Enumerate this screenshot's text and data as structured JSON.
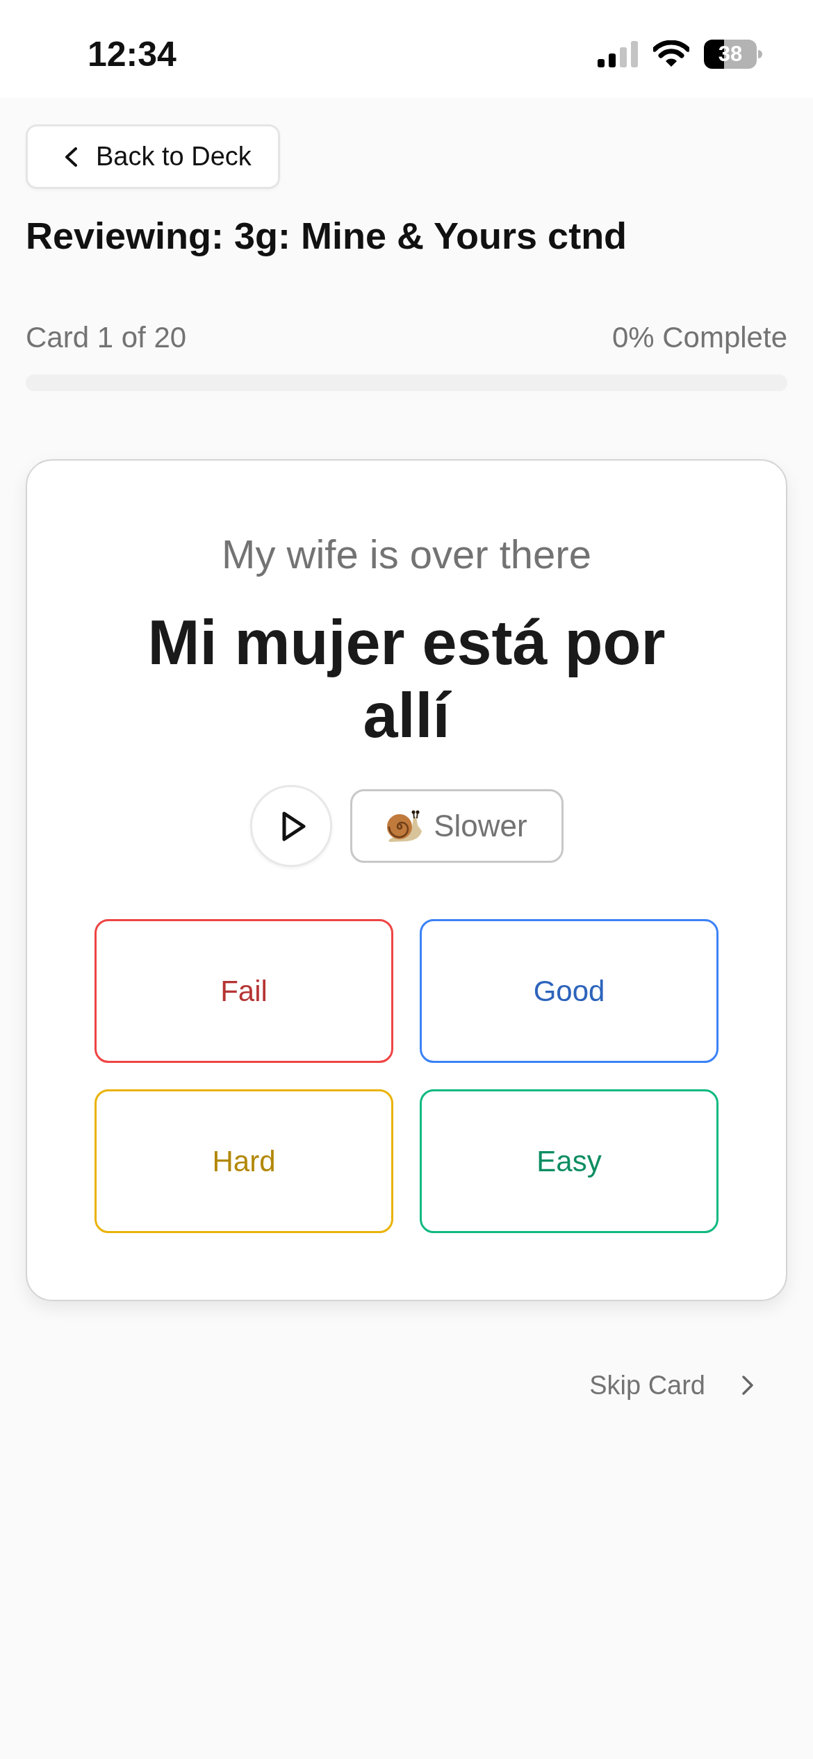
{
  "status_bar": {
    "time": "12:34",
    "battery": "38"
  },
  "back_button": {
    "label": "Back to Deck"
  },
  "title": "Reviewing: 3g: Mine & Yours ctnd",
  "progress": {
    "position": "Card 1 of 20",
    "percent": "0% Complete",
    "level": 0
  },
  "card": {
    "prompt": "My wife is over there",
    "answer": "Mi mujer está por allí",
    "speed_button": "Slower"
  },
  "grade_buttons": [
    {
      "label": "Fail",
      "color": "#ef4444"
    },
    {
      "label": "Good",
      "color": "#3b82f6"
    },
    {
      "label": "Hard",
      "color": "#eab308"
    },
    {
      "label": "Easy",
      "color": "#10b981"
    }
  ],
  "skip_button": {
    "label": "Skip Card"
  }
}
